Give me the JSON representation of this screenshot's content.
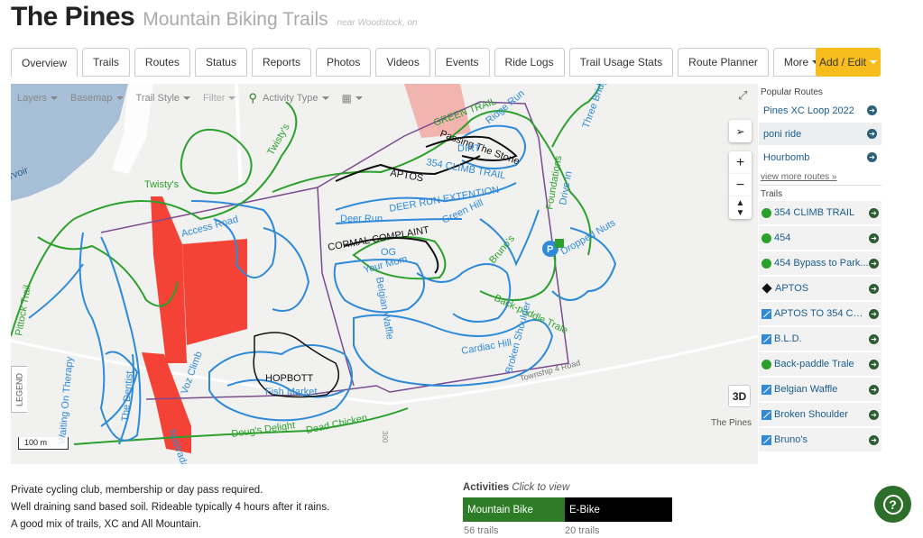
{
  "header": {
    "title": "The Pines",
    "subtitle": "Mountain Biking Trails",
    "near": "near Woodstock, on"
  },
  "tabs": [
    "Overview",
    "Trails",
    "Routes",
    "Status",
    "Reports",
    "Photos",
    "Videos",
    "Events",
    "Ride Logs",
    "Trail Usage Stats",
    "Route Planner",
    "More"
  ],
  "add_edit": "Add / Edit",
  "map": {
    "toolbar": {
      "layers": "Layers",
      "basemap": "Basemap",
      "trail_style": "Trail Style",
      "filter": "Filter",
      "activity_type": "Activity Type"
    },
    "legend": "LEGEND",
    "scale": "100 m",
    "btn_3d": "3D",
    "pines_label": "The Pines",
    "labels": {
      "reservoir": "ervoir",
      "twistys": "Twisty's",
      "twistys2": "Twisty's",
      "access_road": "Access Road",
      "aptos": "APTOS",
      "deer_run": "Deer Run",
      "deer_run_ext": "DEER RUN EXTENTION",
      "green_hill": "Green Hill",
      "cormal": "CORMAL COMPLAINT",
      "og": "OG",
      "your_mom": "Your Mom",
      "brunos": "Bruno's",
      "dropped_nuts": "Dropped Nuts",
      "back_paddle": "Back-paddle Trale",
      "pittock": "Pittock Trail",
      "waiting": "Waiting On Therapy",
      "the_dentist": "The Dentist",
      "nostradamus": "Nostradamus",
      "voz_climb": "Voz Climb",
      "hopbott": "HOPBOTT",
      "fish_market": "Fish Market",
      "dougs_delight": "Doug's Delight",
      "dead_chicken": "Dead Chicken",
      "township": "Township 4 Road",
      "broken_shoulder": "Broken Shoulder",
      "belgian": "Belgian Waffle",
      "ridge_run": "Ridge Run",
      "three_bridges": "Three Bridges",
      "passing": "Passing The Stone",
      "dirt": "DIRT",
      "green_trail": "GREEN TRAIL",
      "foundations": "Foundations",
      "drive_in": "Drive In",
      "rd300": "300",
      "climb_trail": "354 CLIMB TRAIL",
      "cardiac": "Cardiac Hill"
    }
  },
  "sidebar": {
    "popular_label": "Popular Routes",
    "routes": [
      "Pines XC Loop 2022",
      "poni ride",
      "Hourbomb"
    ],
    "more_routes": "view more routes »",
    "trails_label": "Trails",
    "trails": [
      {
        "name": "354 CLIMB TRAIL",
        "icon": "green"
      },
      {
        "name": "454",
        "icon": "green"
      },
      {
        "name": "454 Bypass to Park...",
        "icon": "green"
      },
      {
        "name": "APTOS",
        "icon": "diamond"
      },
      {
        "name": "APTOS TO 354 CO...",
        "icon": "blue"
      },
      {
        "name": "B.L.D.",
        "icon": "blue"
      },
      {
        "name": "Back-paddle Trale",
        "icon": "green"
      },
      {
        "name": "Belgian Waffle",
        "icon": "blue"
      },
      {
        "name": "Broken Shoulder",
        "icon": "blue"
      },
      {
        "name": "Bruno's",
        "icon": "blue"
      }
    ]
  },
  "description": [
    "Private cycling club, membership or day pass required.",
    "Well draining sand based soil. Rideable typically 4 hours after it rains.",
    "A good mix of trails, XC and All Mountain."
  ],
  "activities": {
    "title": "Activities",
    "hint": "Click to view",
    "items": [
      {
        "name": "Mountain Bike",
        "count": "56 trails"
      },
      {
        "name": "E-Bike",
        "count": "20 trails"
      }
    ]
  },
  "colors": {
    "green_trail": "#2ca02c",
    "blue_trail": "#2f8ad8",
    "black_trail": "#111111",
    "closed": "#f44336",
    "boundary": "#7a4b8f",
    "add_edit": "#f6bd1d"
  }
}
